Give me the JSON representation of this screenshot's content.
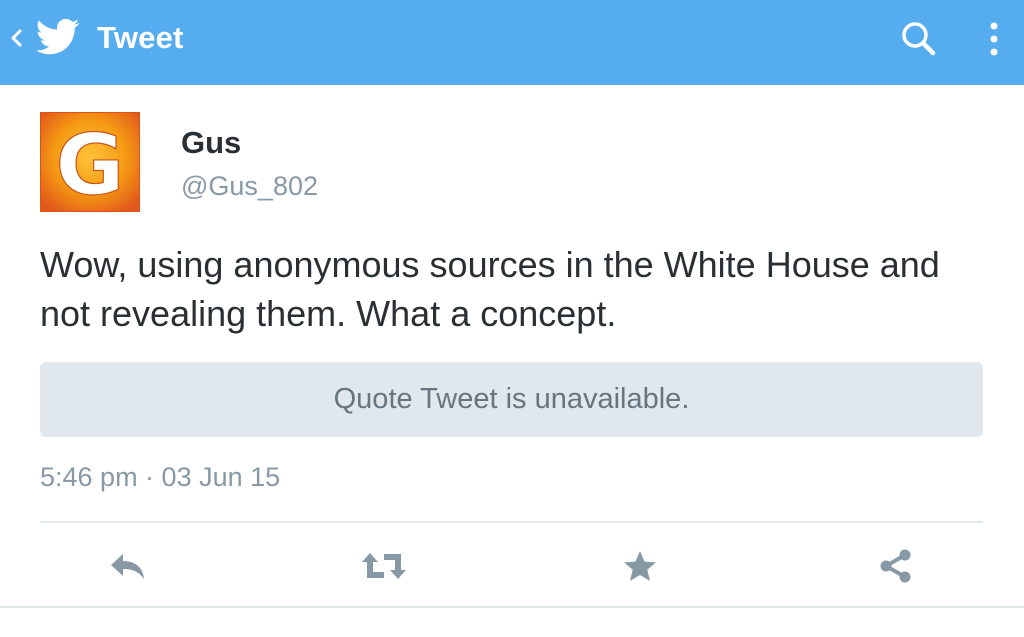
{
  "appbar": {
    "title": "Tweet",
    "background": "#55acee",
    "icons": {
      "back": "back-icon",
      "logo": "twitter-bird-icon",
      "search": "search-icon",
      "menu": "overflow-menu-icon"
    }
  },
  "tweet": {
    "author": {
      "display_name": "Gus",
      "handle": "@Gus_802",
      "avatar_letter": "G"
    },
    "text": "Wow, using anonymous sources in the White House and not revealing them. What a concept.",
    "quote_unavailable": "Quote Tweet is unavailable.",
    "timestamp": "5:46 pm · 03 Jun 15"
  },
  "actions": [
    {
      "name": "reply",
      "icon": "reply-icon"
    },
    {
      "name": "retweet",
      "icon": "retweet-icon"
    },
    {
      "name": "favorite",
      "icon": "star-icon"
    },
    {
      "name": "share",
      "icon": "share-icon"
    }
  ],
  "colors": {
    "accent": "#55acee",
    "muted_text": "#8899a6",
    "action_icon": "#8899a6",
    "quote_bg": "#e1e8ed"
  }
}
